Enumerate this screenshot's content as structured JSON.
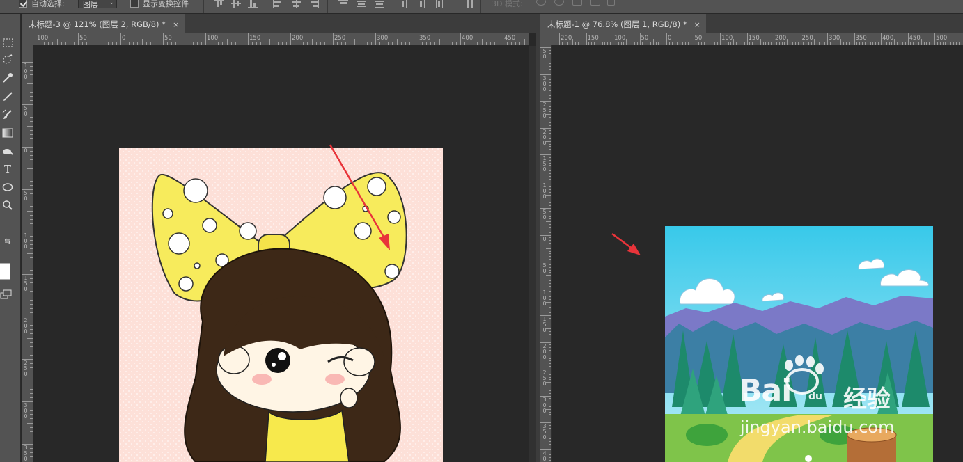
{
  "options_bar": {
    "auto_select_label": "自动选择:",
    "auto_select_checked": true,
    "auto_select_target": "图层",
    "show_transform_label": "显示变换控件",
    "show_transform_checked": false,
    "mode_3d_label": "3D 模式:"
  },
  "tools": [
    "rect-marquee-icon",
    "quick-select-icon",
    "eyedropper-icon",
    "brush-icon",
    "clone-stamp-icon",
    "gradient-icon",
    "smudge-icon",
    "type-icon",
    "ellipse-icon",
    "zoom-icon",
    "swap-colors-icon",
    "screen-mode-icon"
  ],
  "left_document": {
    "tab_title": "未标题-3 @ 121% (图层 2, RGB/8) *",
    "close_glyph": "×",
    "ruler_h_labels": [
      "100",
      "50",
      "0",
      "50",
      "100",
      "150",
      "200",
      "250",
      "300",
      "350",
      "400",
      "450"
    ],
    "ruler_v_labels": [
      "100",
      "50",
      "0",
      "50",
      "100",
      "150",
      "200",
      "250",
      "300",
      "350"
    ]
  },
  "right_document": {
    "tab_title": "未标题-1 @ 76.8% (图层 1, RGB/8) *",
    "close_glyph": "×",
    "ruler_h_labels": [
      "200",
      "150",
      "100",
      "50",
      "0",
      "50",
      "100",
      "150",
      "200",
      "250",
      "300",
      "350",
      "400",
      "450",
      "500"
    ],
    "ruler_v_labels": [
      "50",
      "300",
      "250",
      "200",
      "150",
      "100",
      "50",
      "0",
      "50",
      "100",
      "150",
      "200",
      "250",
      "300",
      "350",
      "400"
    ]
  },
  "watermark": {
    "brand": "Bai",
    "du": "du",
    "jingyan": "经验",
    "url": "jingyan.baidu.com"
  },
  "colors": {
    "workspace": "#282828",
    "panel": "#535353",
    "arrow": "#e8343a",
    "left_canvas_bg": "#fde3dc",
    "sky": "#3ccdea"
  }
}
